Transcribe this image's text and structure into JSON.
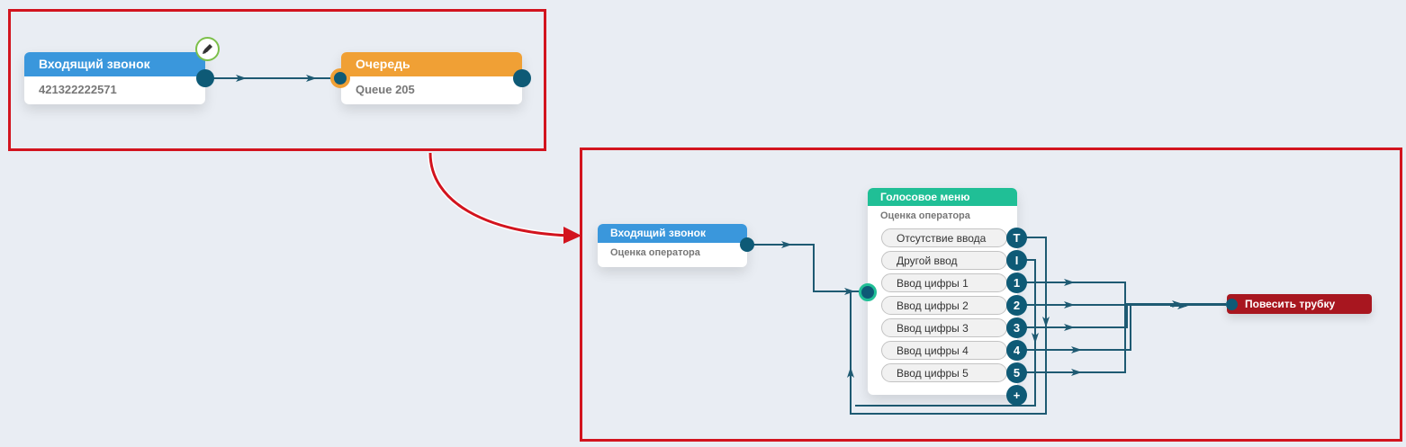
{
  "before": {
    "incoming": {
      "title": "Входящий звонок",
      "number": "421322222571"
    },
    "queue": {
      "title": "Очередь",
      "name": "Queue 205"
    },
    "edit_icon": "pencil-icon"
  },
  "after": {
    "incoming": {
      "title": "Входящий звонок",
      "subtitle": "Оценка оператора"
    },
    "voice_menu": {
      "title": "Голосовое меню",
      "subtitle": "Оценка оператора",
      "options": [
        {
          "label": "Отсутствие ввода",
          "key": "T"
        },
        {
          "label": "Другой ввод",
          "key": "I"
        },
        {
          "label": "Ввод цифры 1",
          "key": "1"
        },
        {
          "label": "Ввод цифры 2",
          "key": "2"
        },
        {
          "label": "Ввод цифры 3",
          "key": "3"
        },
        {
          "label": "Ввод цифры 4",
          "key": "4"
        },
        {
          "label": "Ввод цифры 5",
          "key": "5"
        }
      ],
      "add_label": "+"
    },
    "hangup": {
      "title": "Повесить трубку"
    }
  },
  "colors": {
    "incoming": "#3a97dc",
    "queue": "#f0a035",
    "voice_menu": "#20bf96",
    "hangup": "#a8161f",
    "port": "#0e5a76",
    "highlight": "#d2141e",
    "background": "#e9edf3"
  }
}
